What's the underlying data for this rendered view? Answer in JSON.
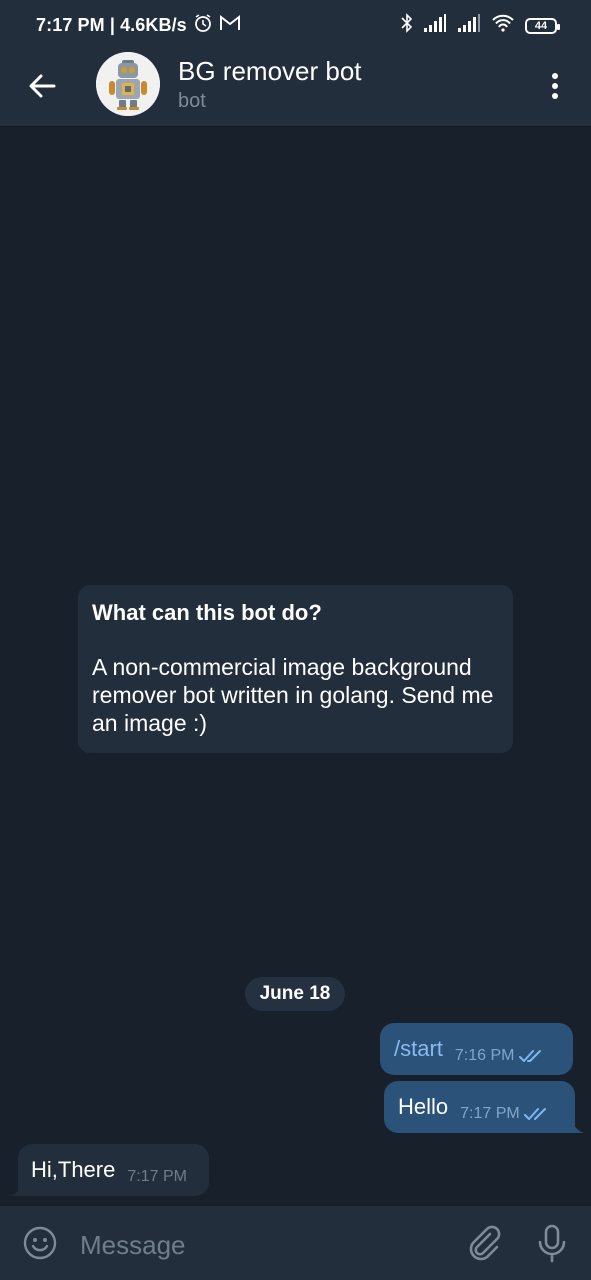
{
  "status_bar": {
    "time_speed": "7:17 PM | 4.6KB/s",
    "battery": "44",
    "icons": [
      "alarm-icon",
      "gmail-icon",
      "bluetooth-icon",
      "signal-icon",
      "signal-icon",
      "wifi-icon",
      "battery-icon"
    ]
  },
  "header": {
    "title": "BG remover bot",
    "subtitle": "bot",
    "icons": [
      "back-arrow-icon",
      "robot-avatar",
      "more-vert-icon"
    ]
  },
  "bot_info": {
    "title": "What can this bot do?",
    "description": "A non-commercial image background remover bot written in golang. Send me an image :)"
  },
  "date_separator": "June 18",
  "messages": [
    {
      "direction": "outgoing",
      "text": "/start",
      "time": "7:16 PM",
      "status": "read"
    },
    {
      "direction": "outgoing",
      "text": "Hello",
      "time": "7:17 PM",
      "status": "read"
    },
    {
      "direction": "incoming",
      "text": "Hi,There",
      "time": "7:17 PM"
    }
  ],
  "composer": {
    "placeholder": "Message",
    "icons": [
      "emoji-icon",
      "attach-icon",
      "mic-icon"
    ]
  },
  "colors": {
    "background": "#18202b",
    "header": "#222e3b",
    "outgoing_bubble": "#2b5278",
    "incoming_bubble": "#222e3b",
    "command_link": "#8ab8ef"
  }
}
